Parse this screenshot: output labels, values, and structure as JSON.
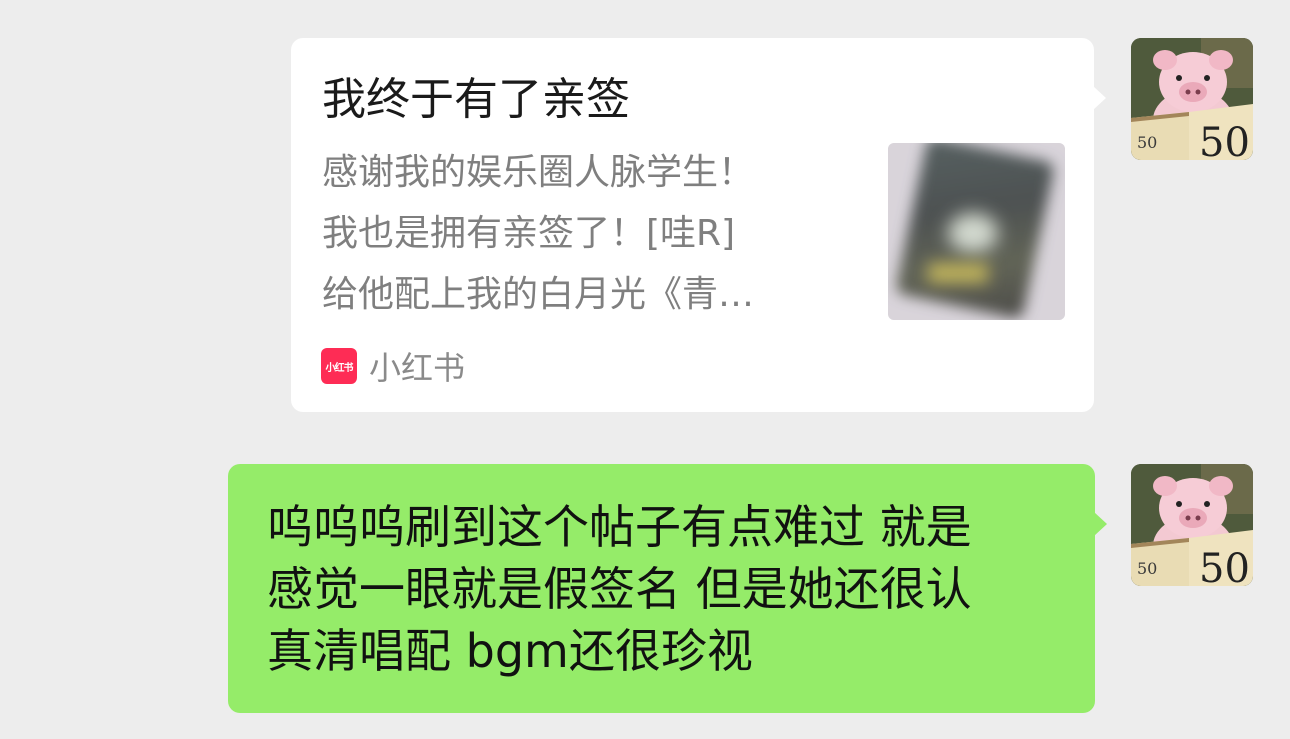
{
  "messages": [
    {
      "type": "share_card",
      "sender": "self",
      "card": {
        "title": "我终于有了亲签",
        "description_lines": [
          "感谢我的娱乐圈人脉学生！",
          "我也是拥有亲签了！[哇R]",
          "给他配上我的白月光《青…"
        ],
        "source_name": "小红书",
        "source_logo_text": "小红书",
        "source_logo_color": "#fe2c55"
      }
    },
    {
      "type": "text",
      "sender": "self",
      "lines": [
        "呜呜呜刷到这个帖子有点难过 就是",
        "感觉一眼就是假签名 但是她还很认",
        "真清唱配 bgm还很珍视"
      ],
      "bubble_color": "#95ec69"
    }
  ],
  "colors": {
    "background": "#ededed",
    "card_background": "#ffffff",
    "self_bubble": "#95ec69"
  }
}
